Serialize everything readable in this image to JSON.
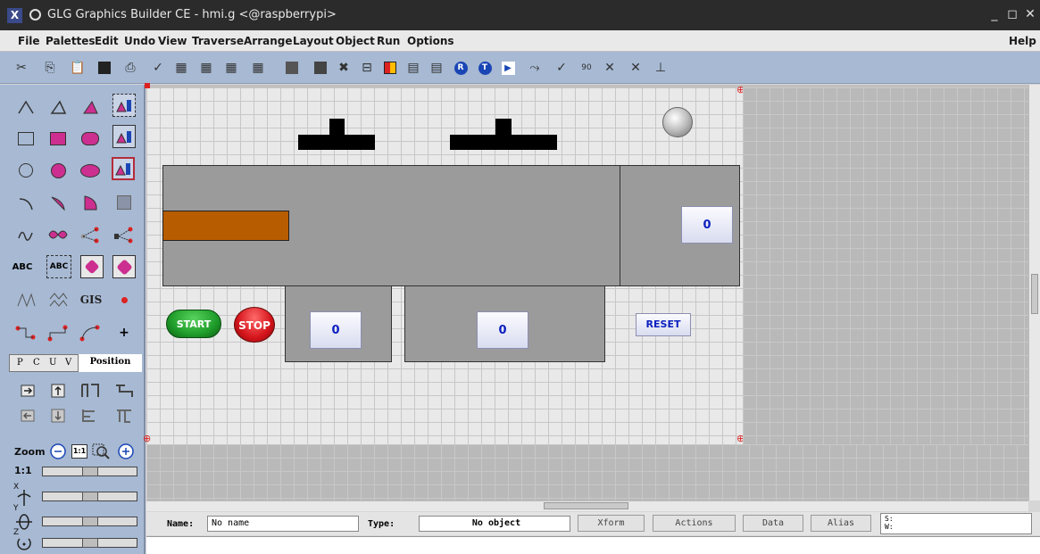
{
  "window": {
    "title": "GLG Graphics Builder CE - hmi.g <@raspberrypi>",
    "app_icon": "X",
    "minimize": "_",
    "maximize": "◻",
    "close": "✕"
  },
  "menu": {
    "file": "File",
    "palettes": "Palettes",
    "edit": "Edit",
    "undo": "Undo",
    "view": "View",
    "traverse": "Traverse",
    "arrange": "Arrange",
    "layout": "Layout",
    "object": "Object",
    "run": "Run",
    "options": "Options",
    "help": "Help"
  },
  "palette": {
    "text_label": "ABC",
    "gis_label": "GIS",
    "plus": "+"
  },
  "tabs": {
    "p": "P",
    "c": "C",
    "u": "U",
    "v": "V",
    "position": "Position"
  },
  "zoom": {
    "label": "Zoom",
    "one_to_one_button": "1:1",
    "ratio_label": "1:1",
    "x_label": "X",
    "y_label": "Y",
    "z_label": "Z"
  },
  "hmi": {
    "start": "START",
    "stop": "STOP",
    "reset": "RESET",
    "value_right": "0",
    "value_left": "0",
    "value_middle": "0"
  },
  "status": {
    "name_label": "Name:",
    "name_value": "No name",
    "type_label": "Type:",
    "type_value": "No object",
    "xform": "Xform",
    "actions": "Actions",
    "data": "Data",
    "alias": "Alias",
    "s_label": "S:",
    "w_label": "W:"
  },
  "colors": {
    "toolbar": "#a7b9d3",
    "orange_bar": "#b85c00",
    "start_green": "#1f9d2a",
    "stop_red": "#d4141b",
    "value_blue": "#0b1fbf"
  }
}
